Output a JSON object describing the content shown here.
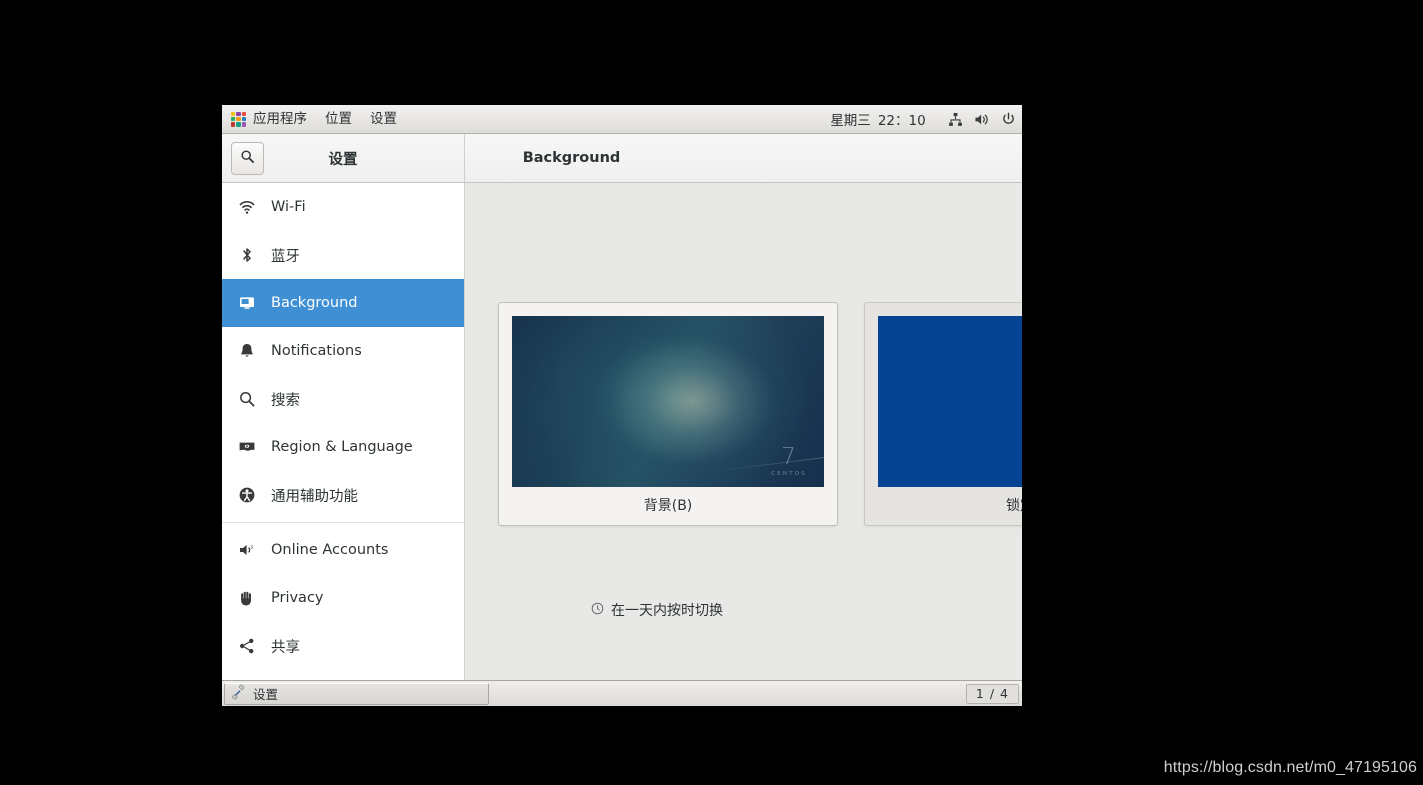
{
  "panel": {
    "menus": [
      {
        "label": "应用程序",
        "icon": "applications-grid-icon"
      },
      {
        "label": "位置",
        "icon": null
      },
      {
        "label": "设置",
        "icon": null
      }
    ],
    "clock": {
      "day": "星期三",
      "time": "22：10"
    },
    "status_icons": [
      {
        "name": "network-wired-icon"
      },
      {
        "name": "volume-icon"
      },
      {
        "name": "power-icon"
      }
    ]
  },
  "window": {
    "sidebar_title": "设置",
    "content_title": "Background",
    "search_icon": "search-icon"
  },
  "sidebar": {
    "groups": [
      {
        "items": [
          {
            "label": "Wi-Fi",
            "icon": "wifi-icon",
            "selected": false
          },
          {
            "label": "蓝牙",
            "icon": "bluetooth-icon",
            "selected": false
          },
          {
            "label": "Background",
            "icon": "monitor-icon",
            "selected": true
          },
          {
            "label": "Notifications",
            "icon": "bell-icon",
            "selected": false
          },
          {
            "label": "搜索",
            "icon": "search-icon",
            "selected": false
          },
          {
            "label": "Region & Language",
            "icon": "flag-icon",
            "selected": false
          },
          {
            "label": "通用辅助功能",
            "icon": "accessibility-icon",
            "selected": false
          }
        ]
      },
      {
        "items": [
          {
            "label": "Online Accounts",
            "icon": "online-accounts-icon",
            "selected": false
          },
          {
            "label": "Privacy",
            "icon": "hand-icon",
            "selected": false
          },
          {
            "label": "共享",
            "icon": "share-icon",
            "selected": false
          }
        ]
      }
    ]
  },
  "content": {
    "cards": [
      {
        "label": "背景(B)",
        "thumb": "centos7-wallpaper",
        "selected": true
      },
      {
        "label": "锁定屏幕",
        "thumb": "solid-blue",
        "selected": false,
        "thumb_color": "#054291"
      }
    ],
    "timed_toggle": {
      "label": "在一天内按时切换",
      "icon": "clock-icon"
    }
  },
  "taskbar": {
    "task": {
      "label": "设置",
      "icon": "tools-icon"
    },
    "workspace": "1 / 4"
  },
  "watermark": "https://blog.csdn.net/m0_47195106",
  "colors": {
    "accent": "#3e8fd4",
    "panel_bg": "#e8e6e3",
    "content_bg": "#e8e8e6",
    "lock_blue": "#054291"
  }
}
